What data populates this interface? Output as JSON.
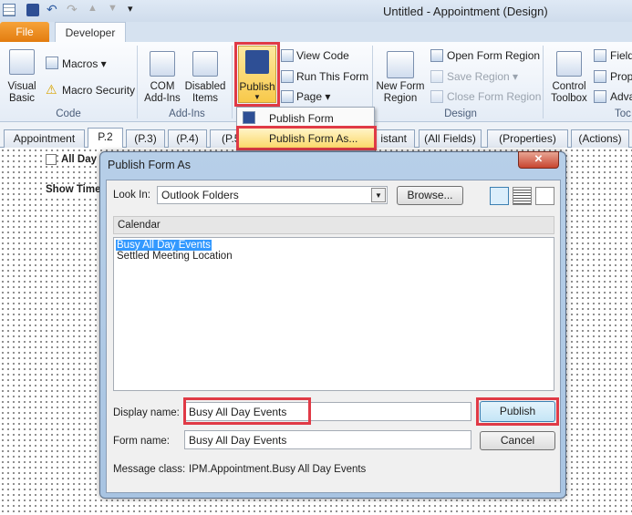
{
  "window": {
    "title": "Untitled  -  Appointment  (Design)"
  },
  "ribbon_tabs": {
    "file": "File",
    "developer": "Developer"
  },
  "code_group": {
    "label": "Code",
    "visual_basic_1": "Visual",
    "visual_basic_2": "Basic",
    "macros": "Macros",
    "macro_security": "Macro Security"
  },
  "addins_group": {
    "label": "Add-Ins",
    "com_1": "COM",
    "com_2": "Add-Ins",
    "disabled_1": "Disabled",
    "disabled_2": "Items"
  },
  "form_group": {
    "publish": "Publish",
    "view_code": "View Code",
    "run_form": "Run This Form",
    "page": "Page"
  },
  "publish_menu": {
    "publish_form": "Publish Form",
    "publish_form_as": "Publish Form As..."
  },
  "design_group": {
    "label": "Design",
    "new_region_1": "New Form",
    "new_region_2": "Region",
    "open_region": "Open Form Region",
    "save_region": "Save Region",
    "close_region": "Close Form Region"
  },
  "tools_group": {
    "label": "Toc",
    "control_1": "Control",
    "control_2": "Toolbox",
    "field": "Field",
    "prop": "Prop",
    "adva": "Adva"
  },
  "form_tabs": [
    "Appointment",
    "P.2",
    "(P.3)",
    "(P.4)",
    "(P.5",
    "istant",
    "(All Fields)",
    "(Properties)",
    "(Actions)"
  ],
  "canvas": {
    "all_day": "All Day",
    "show_time": "Show Time"
  },
  "dialog": {
    "title": "Publish Form As",
    "look_in_label": "Look In:",
    "look_in_value": "Outlook Folders",
    "browse": "Browse...",
    "folder": "Calendar",
    "list_items": [
      "Busy All Day Events",
      "Settled Meeting Location"
    ],
    "display_name_label": "Display name:",
    "display_name_value": "Busy All Day Events",
    "form_name_label": "Form name:",
    "form_name_value": "Busy All Day Events",
    "message_class_label": "Message class:",
    "message_class_value": "IPM.Appointment.Busy All Day Events",
    "publish": "Publish",
    "cancel": "Cancel"
  },
  "colors": {
    "highlight": "#e03a46",
    "file_tab": "#f08a1c",
    "selection": "#3399ff"
  }
}
